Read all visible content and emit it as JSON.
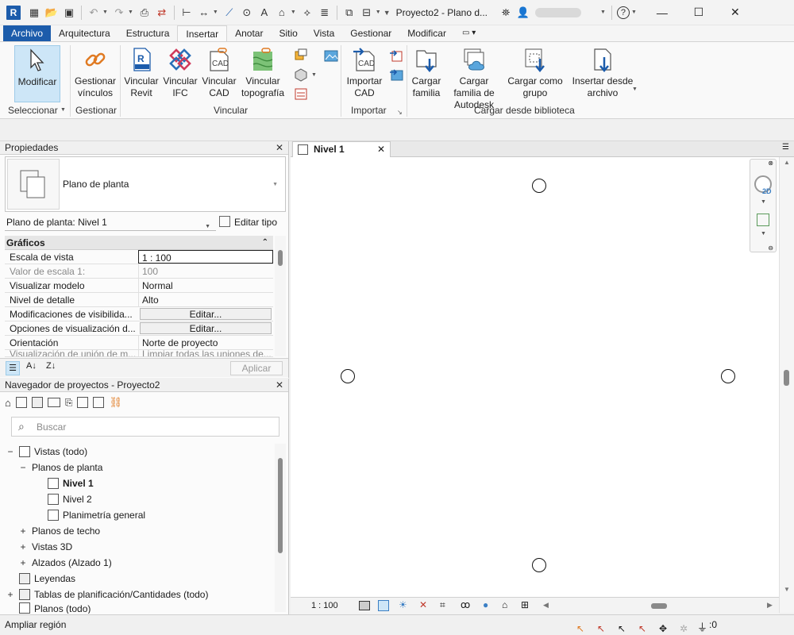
{
  "app": {
    "logo": "R",
    "title": "Proyecto2 - Plano d..."
  },
  "qat": {
    "icons": [
      "open-icon",
      "save-icon",
      "undo-icon",
      "redo-icon",
      "print-icon",
      "sync-icon",
      "measure-icon",
      "dimension-icon",
      "line-icon",
      "tag-icon",
      "text-icon",
      "3d-view-icon",
      "section-icon",
      "thin-lines-icon",
      "close-hidden-icon",
      "switch-windows-icon"
    ]
  },
  "user": {
    "search_icon": "binoculars-icon",
    "user_icon": "user-icon",
    "help": "?"
  },
  "window": {
    "minimize": "—",
    "maximize": "☐",
    "close": "✕"
  },
  "tabs": [
    "Archivo",
    "Arquitectura",
    "Estructura",
    "Insertar",
    "Anotar",
    "Sitio",
    "Vista",
    "Gestionar",
    "Modificar"
  ],
  "active_tab": "Insertar",
  "ribbon": {
    "modify": "Modificar",
    "manage_links": "Gestionar vínculos",
    "link_revit": "Vincular Revit",
    "link_ifc": "Vincular IFC",
    "link_cad": "Vincular CAD",
    "link_topo": "Vincular topografía",
    "import_cad": "Importar CAD",
    "load_family": "Cargar familia",
    "load_autodesk": "Cargar familia de Autodesk",
    "load_group": "Cargar como grupo",
    "insert_file": "Insertar desde archivo",
    "groups": {
      "select": "Seleccionar",
      "manage": "Gestionar",
      "link": "Vincular",
      "import": "Importar",
      "library": "Cargar desde biblioteca"
    }
  },
  "properties": {
    "title": "Propiedades",
    "type_name": "Plano de planta",
    "instance": "Plano de planta: Nivel 1",
    "edit_type": "Editar tipo",
    "section": "Gráficos",
    "rows": [
      {
        "k": "Escala de vista",
        "v": "1 : 100"
      },
      {
        "k": "Valor de escala    1:",
        "v": "100"
      },
      {
        "k": "Visualizar modelo",
        "v": "Normal"
      },
      {
        "k": "Nivel de detalle",
        "v": "Alto"
      },
      {
        "k": "Modificaciones de visibilida...",
        "v": "Editar..."
      },
      {
        "k": "Opciones de visualización d...",
        "v": "Editar..."
      },
      {
        "k": "Orientación",
        "v": "Norte de proyecto"
      },
      {
        "k": "Visualización de unión de m...",
        "v": "Limpiar todas las uniones de..."
      }
    ],
    "apply": "Aplicar"
  },
  "browser": {
    "title": "Navegador de proyectos - Proyecto2",
    "search_placeholder": "Buscar",
    "items": [
      {
        "label": "Vistas (todo)"
      },
      {
        "label": "Planos de planta"
      },
      {
        "label": "Nivel 1"
      },
      {
        "label": "Nivel 2"
      },
      {
        "label": "Planimetría general"
      },
      {
        "label": "Planos de techo"
      },
      {
        "label": "Vistas 3D"
      },
      {
        "label": "Alzados (Alzado 1)"
      },
      {
        "label": "Leyendas"
      },
      {
        "label": "Tablas de planificación/Cantidades (todo)"
      },
      {
        "label": "Planos (todo)"
      }
    ]
  },
  "view": {
    "tab": "Nivel 1",
    "scale": "1 : 100"
  },
  "status": {
    "text": "Ampliar región",
    "filter_count": ":0"
  },
  "colors": {
    "accent": "#1c5cab",
    "selected": "#cde6f7"
  }
}
